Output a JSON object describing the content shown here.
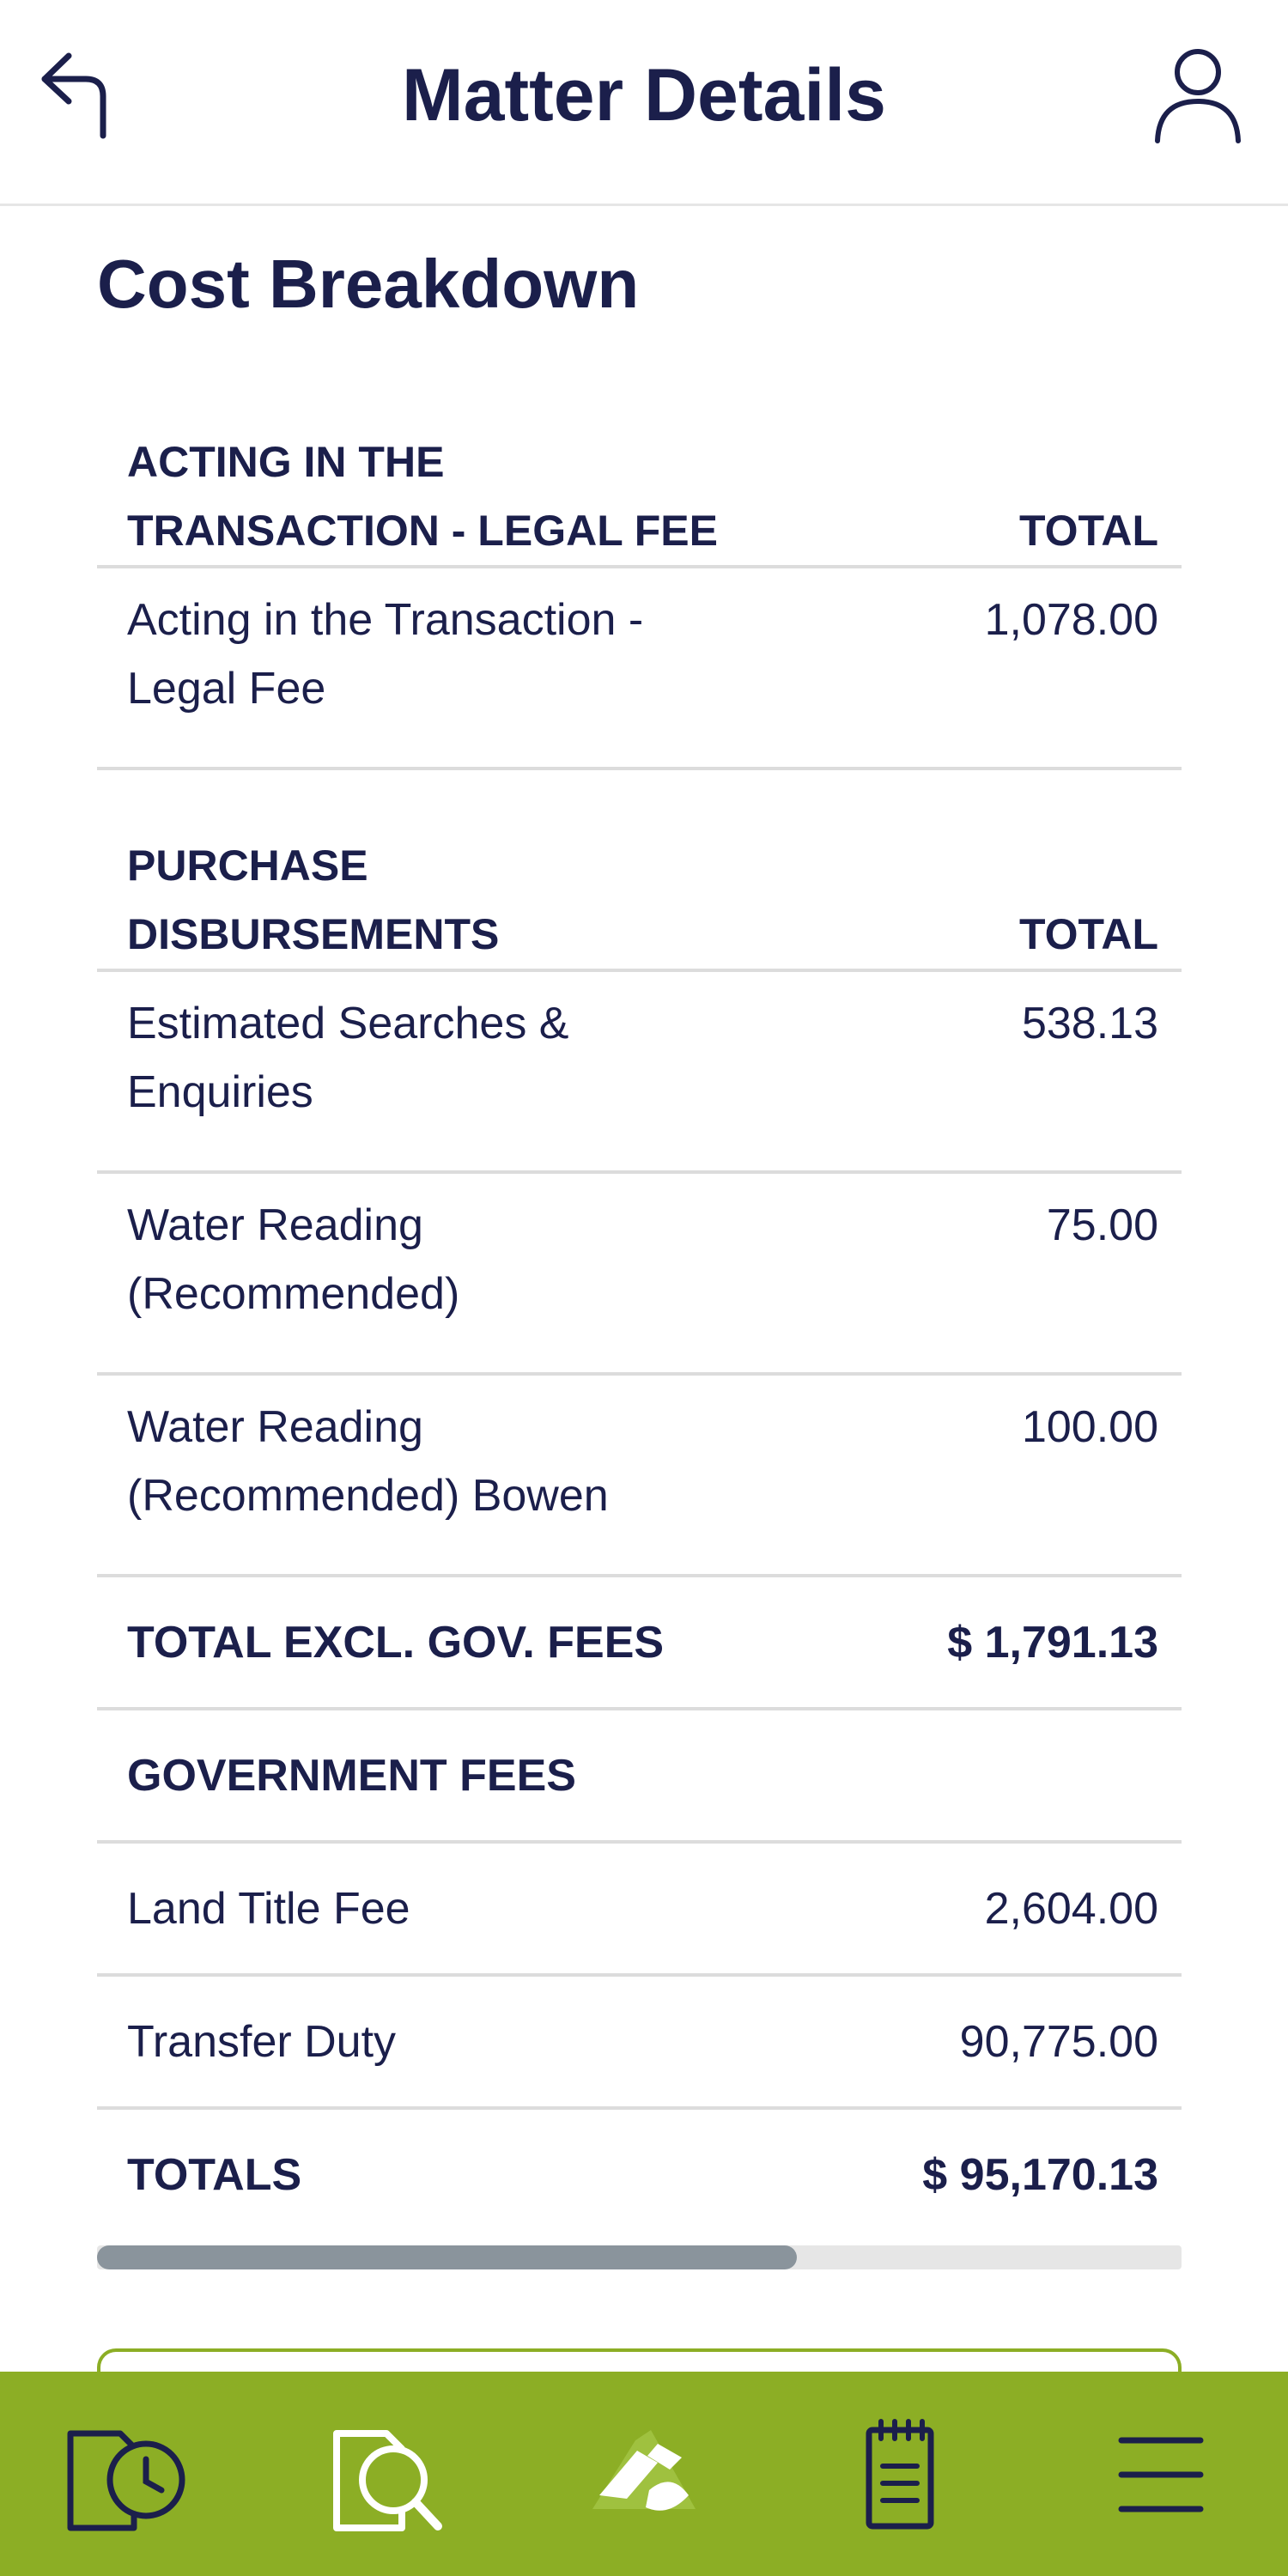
{
  "header": {
    "title": "Matter Details",
    "back_icon": "back-arrow-icon",
    "user_icon": "user-icon"
  },
  "cost_breakdown": {
    "title": "Cost Breakdown",
    "legal_fee_section": {
      "header_line1": "ACTING IN THE",
      "header_line2": "TRANSACTION - LEGAL FEE",
      "total_label": "TOTAL",
      "items": [
        {
          "label_line1": "Acting in the Transaction -",
          "label_line2": "Legal Fee",
          "value": "1,078.00"
        }
      ]
    },
    "disbursements_section": {
      "header_line1": "PURCHASE",
      "header_line2": "DISBURSEMENTS",
      "total_label": "TOTAL",
      "items": [
        {
          "label_line1": "Estimated Searches &",
          "label_line2": "Enquiries",
          "value": "538.13"
        },
        {
          "label_line1": "Water Reading",
          "label_line2": "(Recommended)",
          "value": "75.00"
        },
        {
          "label_line1": "Water Reading",
          "label_line2": "(Recommended) Bowen",
          "value": "100.00"
        }
      ]
    },
    "total_excl": {
      "label": "TOTAL EXCL. GOV. FEES",
      "value": "$ 1,791.13"
    },
    "government_section": {
      "header": "GOVERNMENT FEES",
      "items": [
        {
          "label": "Land Title Fee",
          "value": "2,604.00"
        },
        {
          "label": "Transfer Duty",
          "value": "90,775.00"
        }
      ]
    },
    "totals": {
      "label": "TOTALS",
      "value": "$ 95,170.13"
    }
  },
  "scroll": {
    "position_fraction": 0.0,
    "visible_fraction": 0.645
  },
  "bottom_nav": {
    "items": [
      {
        "icon": "document-clock-icon"
      },
      {
        "icon": "document-search-icon"
      },
      {
        "icon": "app-logo-icon"
      },
      {
        "icon": "notepad-icon"
      },
      {
        "icon": "menu-icon"
      }
    ]
  },
  "colors": {
    "primary_text": "#1b1f4b",
    "accent_green": "#8cae25",
    "divider": "#dcdcdc",
    "scroll_thumb": "#8a949c"
  }
}
